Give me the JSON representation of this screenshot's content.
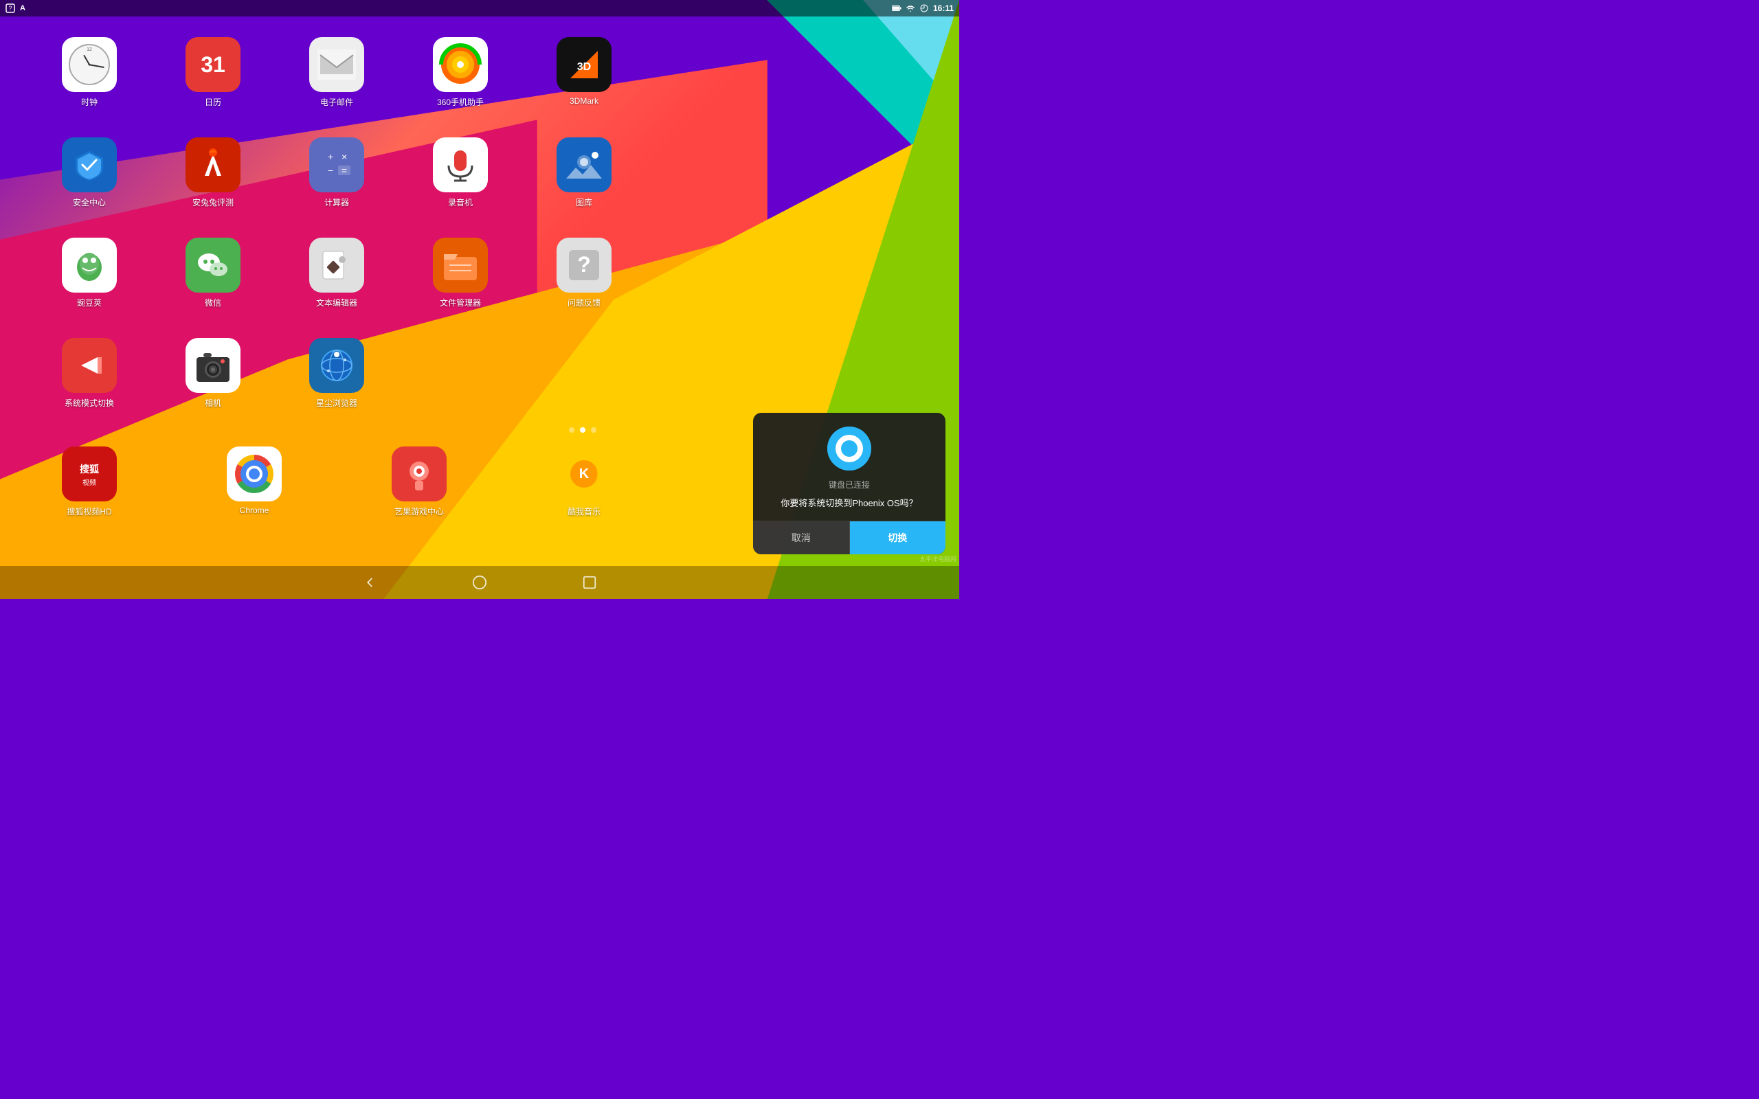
{
  "statusBar": {
    "time": "16:11",
    "icons": [
      "notification",
      "wifi",
      "battery"
    ]
  },
  "apps": [
    {
      "id": "clock",
      "label": "时钟",
      "row": 0,
      "col": 0
    },
    {
      "id": "calendar",
      "label": "日历",
      "row": 0,
      "col": 1,
      "date": "31"
    },
    {
      "id": "email",
      "label": "电子邮件",
      "row": 0,
      "col": 2
    },
    {
      "id": "360",
      "label": "360手机助手",
      "row": 0,
      "col": 3
    },
    {
      "id": "3dmark",
      "label": "3DMark",
      "row": 0,
      "col": 4
    },
    {
      "id": "security",
      "label": "安全中心",
      "row": 1,
      "col": 0
    },
    {
      "id": "antutu",
      "label": "安兔兔评测",
      "row": 1,
      "col": 1
    },
    {
      "id": "calculator",
      "label": "计算器",
      "row": 1,
      "col": 2
    },
    {
      "id": "recorder",
      "label": "录音机",
      "row": 1,
      "col": 3
    },
    {
      "id": "gallery",
      "label": "图库",
      "row": 1,
      "col": 4
    },
    {
      "id": "wandoujia",
      "label": "豌豆荚",
      "row": 2,
      "col": 0
    },
    {
      "id": "wechat",
      "label": "微信",
      "row": 2,
      "col": 1
    },
    {
      "id": "texteditor",
      "label": "文本编辑器",
      "row": 2,
      "col": 2
    },
    {
      "id": "filemanager",
      "label": "文件管理器",
      "row": 2,
      "col": 3
    },
    {
      "id": "feedback",
      "label": "问题反馈",
      "row": 2,
      "col": 4
    },
    {
      "id": "switcher",
      "label": "系统模式切换",
      "row": 3,
      "col": 0
    },
    {
      "id": "camera",
      "label": "相机",
      "row": 3,
      "col": 1
    },
    {
      "id": "stardust",
      "label": "星尘浏览器",
      "row": 3,
      "col": 2
    },
    {
      "id": "sohu",
      "label": "搜狐视频HD",
      "row": 4,
      "col": 0
    },
    {
      "id": "chrome",
      "label": "Chrome",
      "row": 4,
      "col": 1
    },
    {
      "id": "aigo",
      "label": "艺果游戏中心",
      "row": 4,
      "col": 2
    },
    {
      "id": "kugou",
      "label": "酷我音乐",
      "row": 4,
      "col": 3
    }
  ],
  "pageDots": [
    {
      "active": false
    },
    {
      "active": true
    },
    {
      "active": false
    }
  ],
  "dialog": {
    "titleSmall": "键盘已连接",
    "message": "你要将系统切换到Phoenix OS吗？",
    "cancelLabel": "取消",
    "confirmLabel": "切换"
  },
  "navigation": {
    "back": "◁",
    "home": "○",
    "recents": "□"
  },
  "watermark": "太平洋电脑网"
}
